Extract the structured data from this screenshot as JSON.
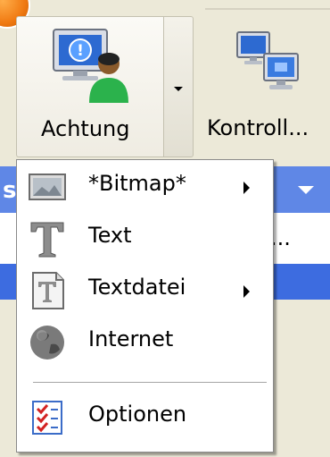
{
  "toolbar": {
    "achtung_label": "Achtung",
    "kontroll_label": "Kontroll..."
  },
  "background": {
    "band_letter": "s",
    "band_dots": "..."
  },
  "menu": {
    "items": [
      {
        "label": "*Bitmap*",
        "icon": "bitmap-image-icon",
        "submenu": true
      },
      {
        "label": "Text",
        "icon": "text-letter-t-icon",
        "submenu": false
      },
      {
        "label": "Textdatei",
        "icon": "text-file-icon",
        "submenu": true
      },
      {
        "label": "Internet",
        "icon": "globe-icon",
        "submenu": false
      }
    ],
    "optionen_label": "Optionen",
    "optionen_icon": "checklist-icon"
  },
  "colors": {
    "band_blue": "#5f87e6",
    "band_blue_dark": "#3d6ce0",
    "toolbar_bg": "#ece9d8",
    "badge_orange": "#f07a12"
  }
}
